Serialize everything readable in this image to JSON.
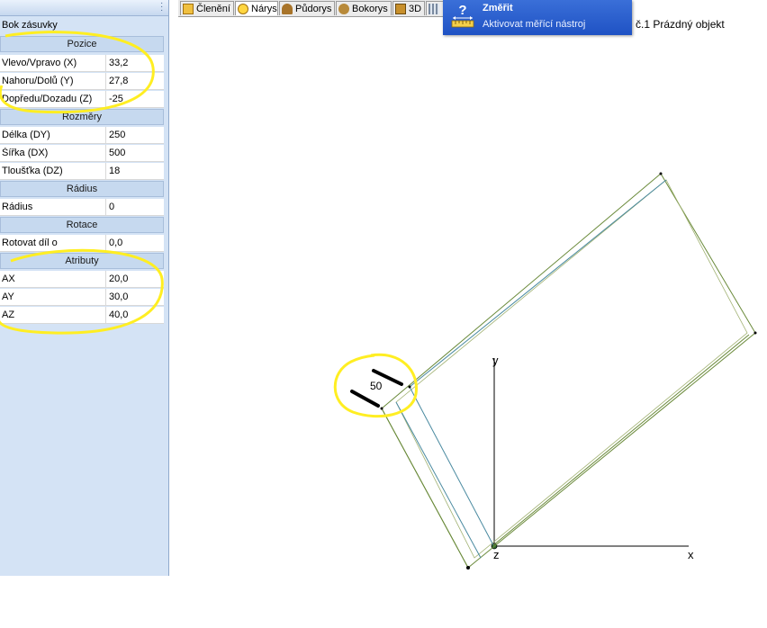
{
  "panel": {
    "title": "Bok zásuvky",
    "sections": {
      "position": "Pozice",
      "dimensions": "Rozměry",
      "radius": "Rádius",
      "rotation": "Rotace",
      "attributes": "Atributy"
    },
    "rows": {
      "x_label": "Vlevo/Vpravo (X)",
      "x_value": "33,2",
      "y_label": "Nahoru/Dolů (Y)",
      "y_value": "27,8",
      "z_label": "Dopředu/Dozadu (Z)",
      "z_value": "-25",
      "dy_label": "Délka (DY)",
      "dy_value": "250",
      "dx_label": "Šířka (DX)",
      "dx_value": "500",
      "dz_label": "Tloušťka (DZ)",
      "dz_value": "18",
      "radius_label": "Rádius",
      "radius_value": "0",
      "rotate_label": "Rotovat díl o",
      "rotate_value": "0,0",
      "ax_label": "AX",
      "ax_value": "20,0",
      "ay_label": "AY",
      "ay_value": "30,0",
      "az_label": "AZ",
      "az_value": "40,0"
    }
  },
  "tabs": [
    "Členění",
    "Nárys",
    "Půdorys",
    "Bokorys",
    "3D"
  ],
  "active_tab": "Nárys",
  "tooltip": {
    "title": "Změřit",
    "description": "Aktivovat měřící nástroj"
  },
  "document_title": "č.1 Prázdný objekt",
  "drawing": {
    "dimension_label": "50",
    "axis_x": "x",
    "axis_y": "y",
    "axis_z": "z"
  },
  "colors": {
    "panel_bg": "#d4e3f5",
    "section_bg": "#c6d9ef",
    "tooltip_bg": "#2a5fd0",
    "part_outline": "#6a8a3a",
    "highlight": "#ffee22"
  }
}
